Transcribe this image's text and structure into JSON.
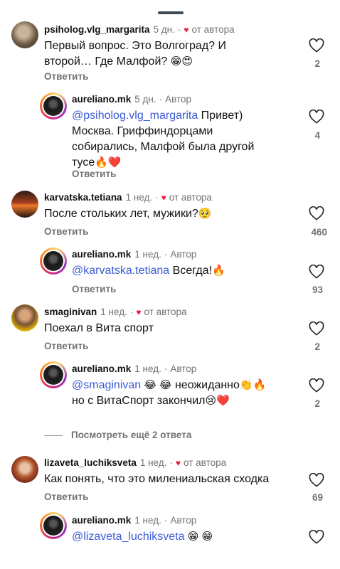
{
  "comments": [
    {
      "user": "psiholog.vlg_margarita",
      "time": "5 дн.",
      "author_badge": "от автора",
      "text": "Первый вопрос. Это Волгоград? И второй… Где Малфой? 😁 😍",
      "text_line1": "Первый вопрос. Это Волгоград? И",
      "text_line2": "второй… Где Малфой?",
      "emoji": "😁😍",
      "reply": "Ответить",
      "likes": "2"
    },
    {
      "user": "aureliano.mk",
      "time": "5 дн.",
      "author_badge": "Автор",
      "mention": "@psiholog.vlg_margarita",
      "text_line1": " Привет)",
      "text_line2": "Москва. Гриффиндорцами",
      "text_line3": "собирались, Малфой была другой",
      "text_line4": "тусе",
      "emoji": "🔥❤️",
      "reply": "Ответить",
      "likes": "4"
    },
    {
      "user": "karvatska.tetiana",
      "time": "1 нед.",
      "author_badge": "от автора",
      "text_line1": "После стольких лет, мужики?",
      "emoji": "🥺",
      "reply": "Ответить",
      "likes": "460"
    },
    {
      "user": "aureliano.mk",
      "time": "1 нед.",
      "author_badge": "Автор",
      "mention": "@karvatska.tetiana",
      "text_line1": " Всегда!",
      "emoji": "🔥",
      "reply": "Ответить",
      "likes": "93"
    },
    {
      "user": "smaginivan",
      "time": "1 нед.",
      "author_badge": "от автора",
      "text_line1": "Поехал в Вита спорт",
      "reply": "Ответить",
      "likes": "2"
    },
    {
      "user": "aureliano.mk",
      "time": "1 нед.",
      "author_badge": "Автор",
      "mention": "@smaginivan",
      "emoji1": " 😂 😂",
      "text_line1": " неожиданно",
      "emoji2": "👏🔥",
      "text_line2": "но с ВитаСпорт закончил",
      "emoji3": "😢❤️",
      "likes": "2"
    },
    {
      "user": "lizaveta_luchiksveta",
      "time": "1 нед.",
      "author_badge": "от автора",
      "text_line1": "Как понять, что это милениальская сходка",
      "reply": "Ответить",
      "likes": "69"
    },
    {
      "user": "aureliano.mk",
      "time": "1 нед.",
      "author_badge": "Автор",
      "mention": "@lizaveta_luchiksveta",
      "emoji": " 😁 😁"
    }
  ],
  "more_replies": "Посмотреть ещё 2 ответа",
  "colors": {
    "mention": "#3b5bd6",
    "heart_red": "#ed1b3b",
    "muted": "#737373"
  }
}
